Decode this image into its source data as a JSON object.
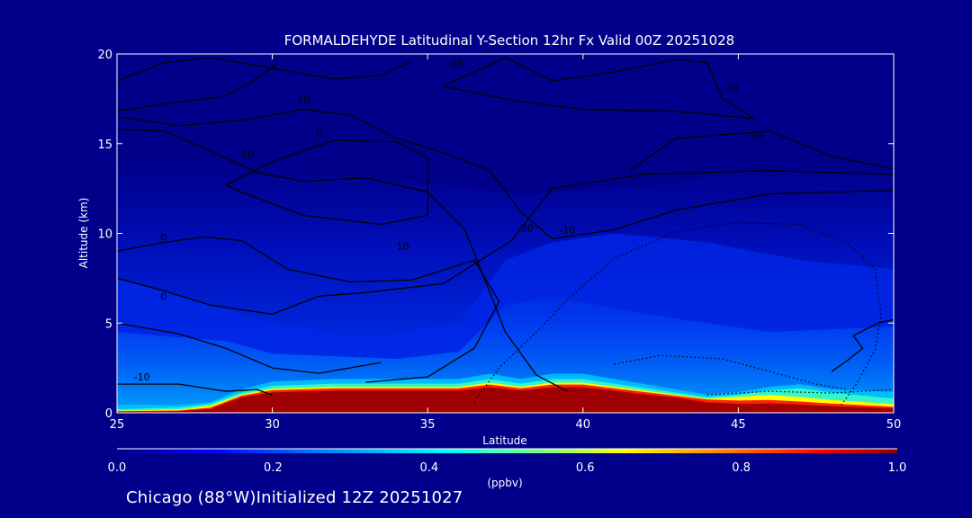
{
  "title": "FORMALDEHYDE Latitudinal Y-Section 12hr  Fx Valid 00Z 20251028",
  "footer": "Chicago (88°W)Initialized 12Z 20251027",
  "colors": {
    "background": "#00008a",
    "frame": "#ffffff",
    "contour": "#000000"
  },
  "chart_data": {
    "type": "heatmap",
    "xlabel": "Latitude",
    "ylabel": "Altitude (km)",
    "xlim": [
      25,
      50
    ],
    "ylim": [
      0,
      20
    ],
    "x_ticks": [
      "25",
      "30",
      "35",
      "40",
      "45",
      "50"
    ],
    "y_ticks": [
      "0",
      "5",
      "10",
      "15",
      "20"
    ],
    "colorbar": {
      "label": "(ppbv)",
      "range": [
        0.0,
        1.0
      ],
      "ticks": [
        "0.0",
        "0.2",
        "0.4",
        "0.6",
        "0.8",
        "1.0"
      ],
      "colormap": [
        "#00008b",
        "#0000ff",
        "#00a0ff",
        "#00ffff",
        "#80ff80",
        "#ffff00",
        "#ff8000",
        "#ff0000",
        "#8b0000"
      ]
    },
    "field": {
      "surface_layer": {
        "lat": [
          25,
          27,
          28,
          29,
          30,
          32,
          34,
          36,
          37,
          38,
          39,
          40,
          41,
          42,
          43,
          44,
          45,
          46,
          47,
          48,
          50
        ],
        "top_km": [
          0.3,
          0.3,
          0.4,
          0.9,
          1.2,
          1.3,
          1.3,
          1.3,
          1.5,
          1.3,
          1.5,
          1.5,
          1.3,
          1.1,
          0.9,
          0.7,
          0.8,
          1.0,
          1.1,
          0.9,
          0.8
        ],
        "peak_ppbv": [
          0.2,
          0.3,
          0.5,
          1.0,
          1.0,
          1.0,
          1.0,
          1.0,
          1.0,
          1.0,
          1.0,
          1.0,
          1.0,
          0.9,
          0.9,
          0.8,
          0.6,
          0.5,
          0.4,
          0.4,
          0.3
        ]
      },
      "background_ppbv": 0.05,
      "midlevel_ppbv": 0.15
    },
    "contour_labels": [
      "10",
      "0",
      "-10",
      "20",
      "30",
      "10",
      "0",
      "10",
      "20",
      "-10",
      "0",
      "-10"
    ]
  }
}
